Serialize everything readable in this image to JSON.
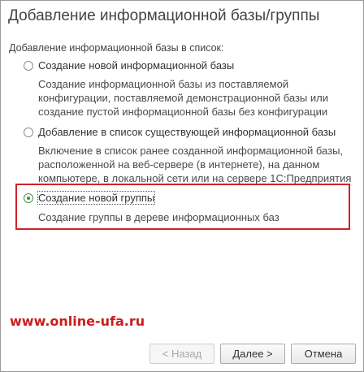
{
  "dialog": {
    "title": "Добавление информационной базы/группы",
    "section_label": "Добавление информационной базы в список:"
  },
  "options": [
    {
      "label": "Создание новой информационной базы",
      "selected": false,
      "description": [
        "Создание информационной базы из поставляемой",
        "конфигурации, поставляемой демонстрационной базы или",
        "создание пустой информационной базы без конфигурации"
      ]
    },
    {
      "label": "Добавление в список существующей информационной базы",
      "selected": false,
      "description": [
        "Включение в список ранее созданной информационной базы,",
        "расположенной на веб-сервере (в интернете), на данном",
        "компьютере,  в локальной сети или на сервере 1С:Предприятия"
      ]
    },
    {
      "label": "Создание новой группы",
      "selected": true,
      "description": [
        "Создание группы в дереве информационных баз"
      ]
    }
  ],
  "watermark": "www.online-ufa.ru",
  "buttons": {
    "back": "< Назад",
    "next": "Далее >",
    "cancel": "Отмена"
  },
  "colors": {
    "highlight_border": "#d0212c",
    "watermark": "#c81e1e",
    "radio_selected": "#3b8f3b"
  }
}
